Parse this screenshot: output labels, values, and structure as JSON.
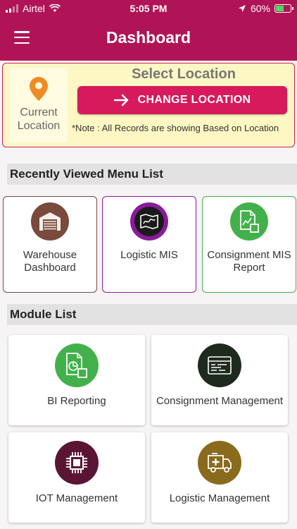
{
  "status_bar": {
    "carrier": "Airtel",
    "time": "5:05 PM",
    "battery": "60%",
    "battery_level": 0.6
  },
  "header": {
    "title": "Dashboard",
    "color": "#b01456"
  },
  "location": {
    "current_label": "Current Location",
    "select_title": "Select Location",
    "change_button": "CHANGE LOCATION",
    "note": "*Note : All Records are showing Based on Location",
    "pin_color": "#f08a24"
  },
  "recent": {
    "heading": "Recently Viewed Menu List",
    "items": [
      {
        "label": "Warehouse Dashboard",
        "icon": "warehouse-icon",
        "icon_bg": "#7a4a3c",
        "border": "#7a4a3c"
      },
      {
        "label": "Logistic MIS",
        "icon": "map-icon",
        "icon_bg": "#8b1a9c",
        "border": "#8b1a9c"
      },
      {
        "label": "Consignment MIS Report",
        "icon": "report-icon",
        "icon_bg": "#43b14b",
        "border": "#43b14b"
      }
    ]
  },
  "modules": {
    "heading": "Module List",
    "items": [
      {
        "label": "BI Reporting",
        "icon": "bi-report-icon",
        "icon_bg": "#43b14b"
      },
      {
        "label": "Consignment Management",
        "icon": "terminal-icon",
        "icon_bg": "#1f2a1f"
      },
      {
        "label": "IOT Management",
        "icon": "chip-icon",
        "icon_bg": "#5a1534"
      },
      {
        "label": "Logistic Management",
        "icon": "ambulance-icon",
        "icon_bg": "#8a6a1c"
      }
    ]
  }
}
